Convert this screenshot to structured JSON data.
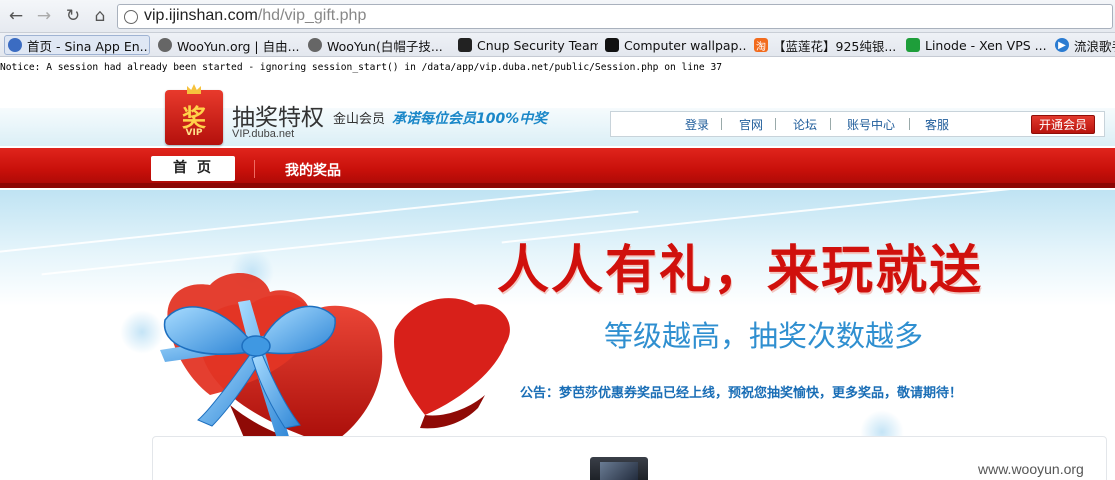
{
  "browser": {
    "url_host": "vip.ijinshan.com",
    "url_path": "/hd/vip_gift.php",
    "bookmarks": [
      {
        "label": "首页 - Sina App En...",
        "icon": "sina-app-icon",
        "color": "#3b6cc2"
      },
      {
        "label": "WooYun.org | 自由...",
        "icon": "wooyun-icon",
        "color": "#555555"
      },
      {
        "label": "WooYun(白帽子技...",
        "icon": "wooyun-icon",
        "color": "#555555"
      },
      {
        "label": "Cnup Security Team",
        "icon": "cnup-icon",
        "color": "#222222"
      },
      {
        "label": "Computer wallpap...",
        "icon": "wallpaper-icon",
        "color": "#111111"
      },
      {
        "label": "【蓝莲花】925纯银...",
        "icon": "taobao-icon",
        "color": "#f26b1d"
      },
      {
        "label": "Linode - Xen VPS ...",
        "icon": "linode-icon",
        "color": "#1e9e3a"
      },
      {
        "label": "流浪歌手",
        "icon": "play-icon",
        "color": "#2a7bd1"
      }
    ]
  },
  "notice": "Notice: A session had already been started - ignoring session_start() in /data/app/vip.duba.net/public/Session.php on line 37",
  "site": {
    "logo_char": "奖",
    "logo_vip": "VIP",
    "brand_title": "抽奖特权",
    "brand_sub": "金山会员",
    "brand_domain": "VIP.duba.net",
    "slogan": "承诺每位会员100%中奖",
    "topnav": [
      "登录",
      "官网",
      "论坛",
      "账号中心",
      "客服"
    ],
    "open_vip": "开通会员",
    "tabs": {
      "home": "首页",
      "prizes": "我的奖品"
    }
  },
  "banner": {
    "headline": "人人有礼，来玩就送",
    "subline": "等级越高，抽奖次数越多",
    "announcement": "公告：梦芭莎优惠券奖品已经上线，预祝您抽奖愉快，更多奖品，敬请期待！"
  },
  "watermark": "www.wooyun.org",
  "colors": {
    "brand_red": "#c8100a",
    "link_blue": "#1f5c9a",
    "ribbon_blue": "#4aa8e6"
  }
}
